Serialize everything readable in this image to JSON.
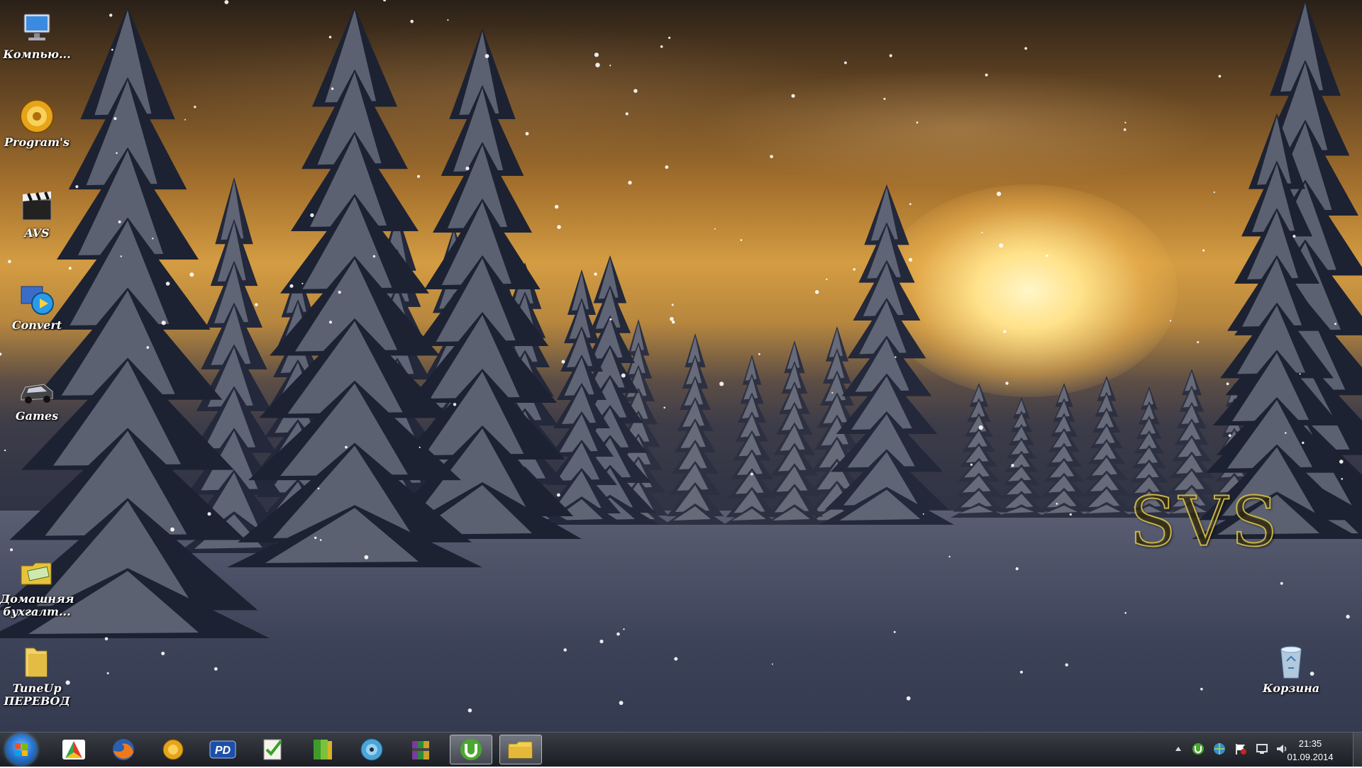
{
  "desktop": {
    "icons": [
      {
        "label": "Компью...",
        "icon": "computer-icon"
      },
      {
        "label": "Program's",
        "icon": "program-gear-icon"
      },
      {
        "label": "AVS",
        "icon": "clapperboard-icon"
      },
      {
        "label": "Convert",
        "icon": "media-convert-icon"
      },
      {
        "label": "Games",
        "icon": "car-icon"
      },
      {
        "label": "Домашняя\nбухгалт...",
        "icon": "folder-money-icon"
      },
      {
        "label": "TuneUp\nПЕРЕВОД",
        "icon": "folder-icon"
      }
    ],
    "recycle_bin": {
      "label": "Корзина",
      "icon": "recycle-bin-icon"
    },
    "watermark": "SVS"
  },
  "taskbar": {
    "pinned": [
      {
        "name": "start-button",
        "icon": "windows-orb-icon"
      },
      {
        "name": "taskbar-app-1",
        "icon": "colorful-arrow-icon"
      },
      {
        "name": "taskbar-firefox",
        "icon": "firefox-icon"
      },
      {
        "name": "taskbar-gamepad",
        "icon": "gamepad-icon"
      },
      {
        "name": "taskbar-pd",
        "icon": "pd-icon"
      },
      {
        "name": "taskbar-notepad",
        "icon": "notepad-check-icon"
      },
      {
        "name": "taskbar-books",
        "icon": "book-icon"
      },
      {
        "name": "taskbar-disc",
        "icon": "disc-icon"
      },
      {
        "name": "taskbar-archive",
        "icon": "archive-icon"
      },
      {
        "name": "taskbar-utorrent",
        "icon": "utorrent-icon"
      },
      {
        "name": "taskbar-explorer",
        "icon": "explorer-folder-icon"
      }
    ],
    "pd_label": "PD",
    "tray_icons": [
      "chevron-up-icon",
      "utorrent-tray-icon",
      "network-globe-icon",
      "flag-icon",
      "monitor-icon",
      "speaker-icon"
    ],
    "clock": {
      "time": "21:35",
      "date": "01.09.2014"
    }
  },
  "colors": {
    "accent": "#2a78d0",
    "utorrent": "#4aa830"
  }
}
